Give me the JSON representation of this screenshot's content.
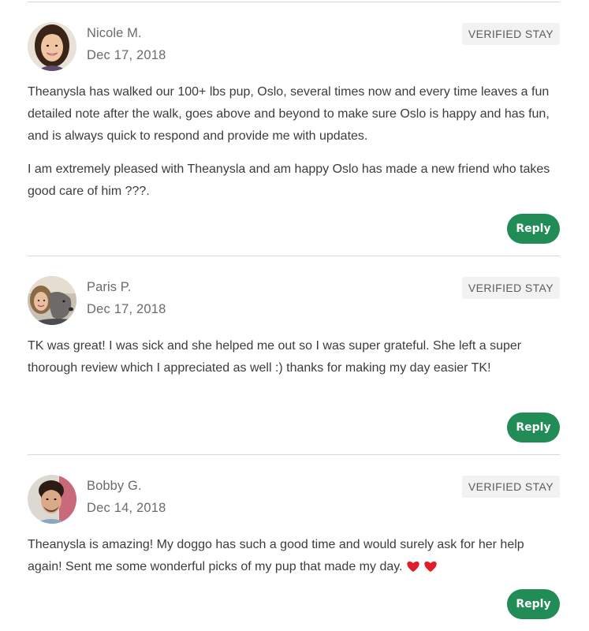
{
  "reviews": [
    {
      "name": "Nicole M.",
      "date": "Dec 17, 2018",
      "badge": "VERIFIED STAY",
      "paragraphs": [
        "Theanysla has walked our 100+ lbs pup, Oslo, several times now and every time leaves a fun detailed note after the walk, goes above and beyond to make sure Oslo is happy and has fun, and is always quick to respond and provide me with updates.",
        "I am extremely pleased with Theanysla and am happy Oslo has made a new friend who takes good care of him ???."
      ],
      "reply_label": "Reply",
      "avatar_icon": "person-photo-avatar"
    },
    {
      "name": "Paris P.",
      "date": "Dec 17, 2018",
      "badge": "VERIFIED STAY",
      "paragraphs": [
        "TK was great! I was sick and she helped me out so I was super grateful. She left a super thorough review which I appreciated as well :) thanks for making my day easier TK!"
      ],
      "reply_label": "Reply",
      "avatar_icon": "person-with-dog-avatar"
    },
    {
      "name": "Bobby G.",
      "date": "Dec 14, 2018",
      "badge": "VERIFIED STAY",
      "paragraphs": [
        "Theanysla is amazing! My doggo has such a good time and would surely ask for her help again! Sent me some wonderful picks of my pup that made my day."
      ],
      "reply_label": "Reply",
      "avatar_icon": "person-photo-avatar",
      "trailing_icons": [
        "heart-icon",
        "heart-icon"
      ]
    }
  ],
  "colors": {
    "reply_button": "#218c55",
    "badge_bg": "#f2f2f2",
    "divider": "#d6d6d6",
    "heart": "#e01e2b"
  }
}
